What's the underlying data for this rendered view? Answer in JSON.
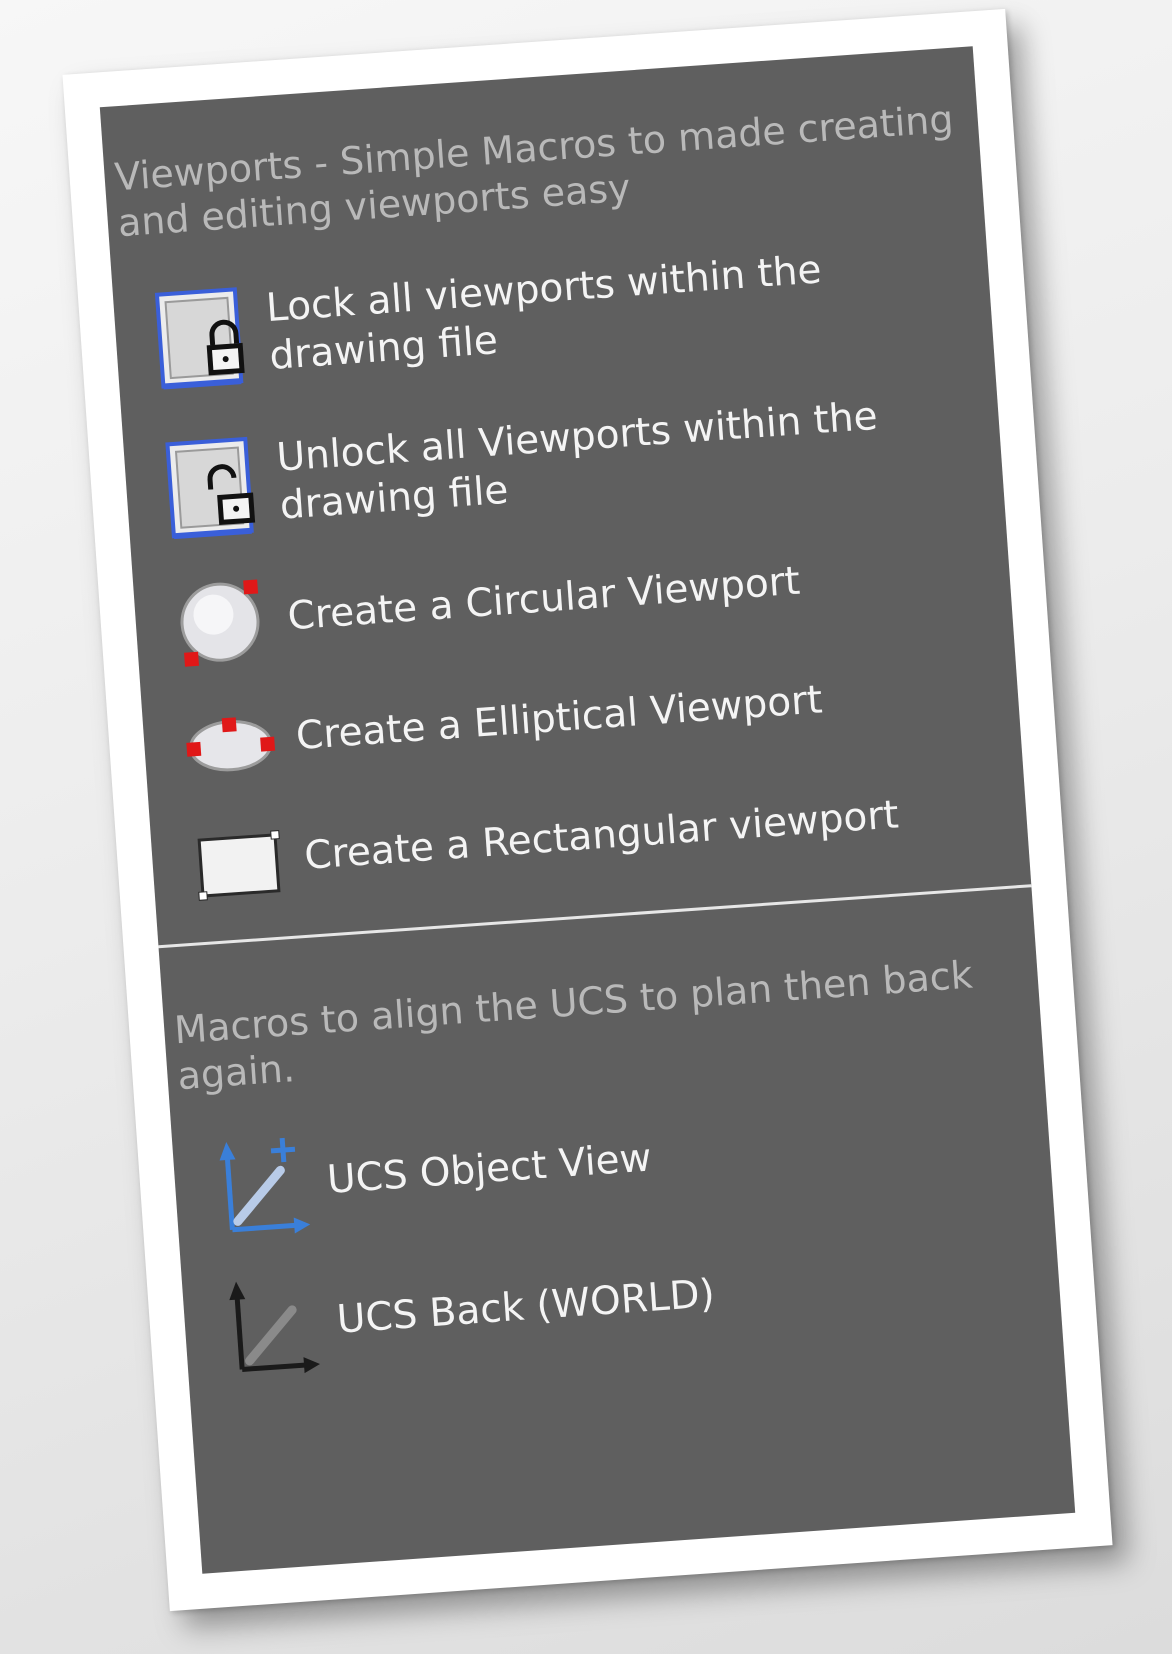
{
  "sections": [
    {
      "description": "Viewports - Simple Macros to made creating and editing viewports easy",
      "items": [
        {
          "label": "Lock all viewports within the drawing file",
          "icon": "lock-viewport-icon"
        },
        {
          "label": "Unlock all Viewports within the drawing file",
          "icon": "unlock-viewport-icon"
        },
        {
          "label": "Create a Circular Viewport",
          "icon": "circular-viewport-icon"
        },
        {
          "label": "Create a Elliptical Viewport",
          "icon": "elliptical-viewport-icon"
        },
        {
          "label": "Create a Rectangular viewport",
          "icon": "rectangular-viewport-icon"
        }
      ]
    },
    {
      "description": "Macros to align the UCS to plan then back again.",
      "items": [
        {
          "label": "UCS Object View",
          "icon": "ucs-object-icon"
        },
        {
          "label": "UCS Back (WORLD)",
          "icon": "ucs-world-icon"
        }
      ]
    }
  ],
  "colors": {
    "panel_background": "#5f5f5f",
    "description_text": "#b9b9b9",
    "item_text": "#f4f4f4",
    "accent_blue": "#3a5fd9",
    "grip_red": "#e01818",
    "divider": "#e7e7e7"
  }
}
